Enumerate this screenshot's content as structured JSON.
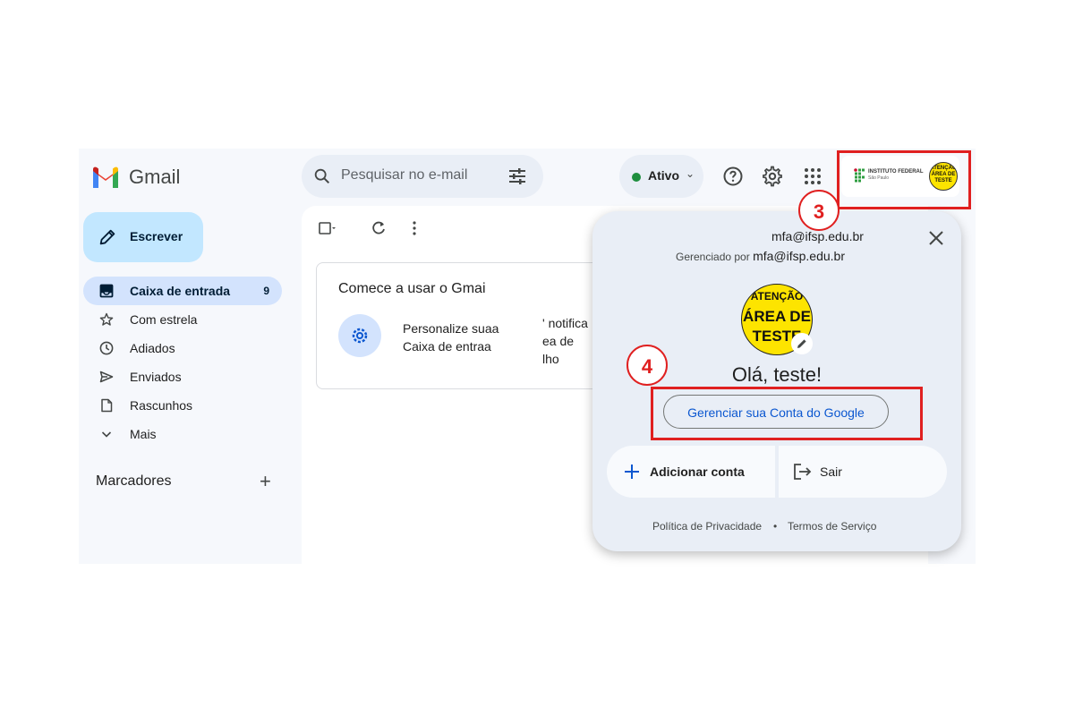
{
  "app": {
    "name": "Gmail"
  },
  "search": {
    "placeholder": "Pesquisar no e-mail"
  },
  "status": {
    "label": "Ativo"
  },
  "account_chip": {
    "org_line1": "INSTITUTO FEDERAL",
    "org_line2": "São Paulo",
    "avatar_text": "ATENÇÃO ÁREA DE TESTE"
  },
  "sidebar": {
    "compose_label": "Escrever",
    "items": [
      {
        "label": "Caixa de entrada",
        "count": "9",
        "icon": "inbox-icon"
      },
      {
        "label": "Com estrela",
        "icon": "star-icon"
      },
      {
        "label": "Adiados",
        "icon": "clock-icon"
      },
      {
        "label": "Enviados",
        "icon": "send-icon"
      },
      {
        "label": "Rascunhos",
        "icon": "draft-icon"
      },
      {
        "label": "Mais",
        "icon": "chevron-down-icon"
      }
    ],
    "labels_title": "Marcadores"
  },
  "main": {
    "card_title": "Comece a usar o Gmai",
    "card_item1_line1": "Personalize suaa",
    "card_item1_line2": "Caixa de entraa",
    "card_item2_line1": "' notifica",
    "card_item2_line2": "ea de",
    "card_item2_line3": "lho"
  },
  "popup": {
    "email": "mfa@ifsp.edu.br",
    "managed_prefix": "Gerenciado por",
    "managed_email": "mfa@ifsp.edu.br",
    "avatar_line1": "ATENÇÃO",
    "avatar_line2": "ÁREA DE",
    "avatar_line3": "TESTE",
    "greeting": "Olá, teste!",
    "manage_button": "Gerenciar sua Conta do Google",
    "add_account": "Adicionar conta",
    "sign_out": "Sair",
    "privacy": "Política de Privacidade",
    "separator": "•",
    "terms": "Termos de Serviço"
  },
  "annotations": {
    "step3": "3",
    "step4": "4",
    "color": "#e02020"
  }
}
